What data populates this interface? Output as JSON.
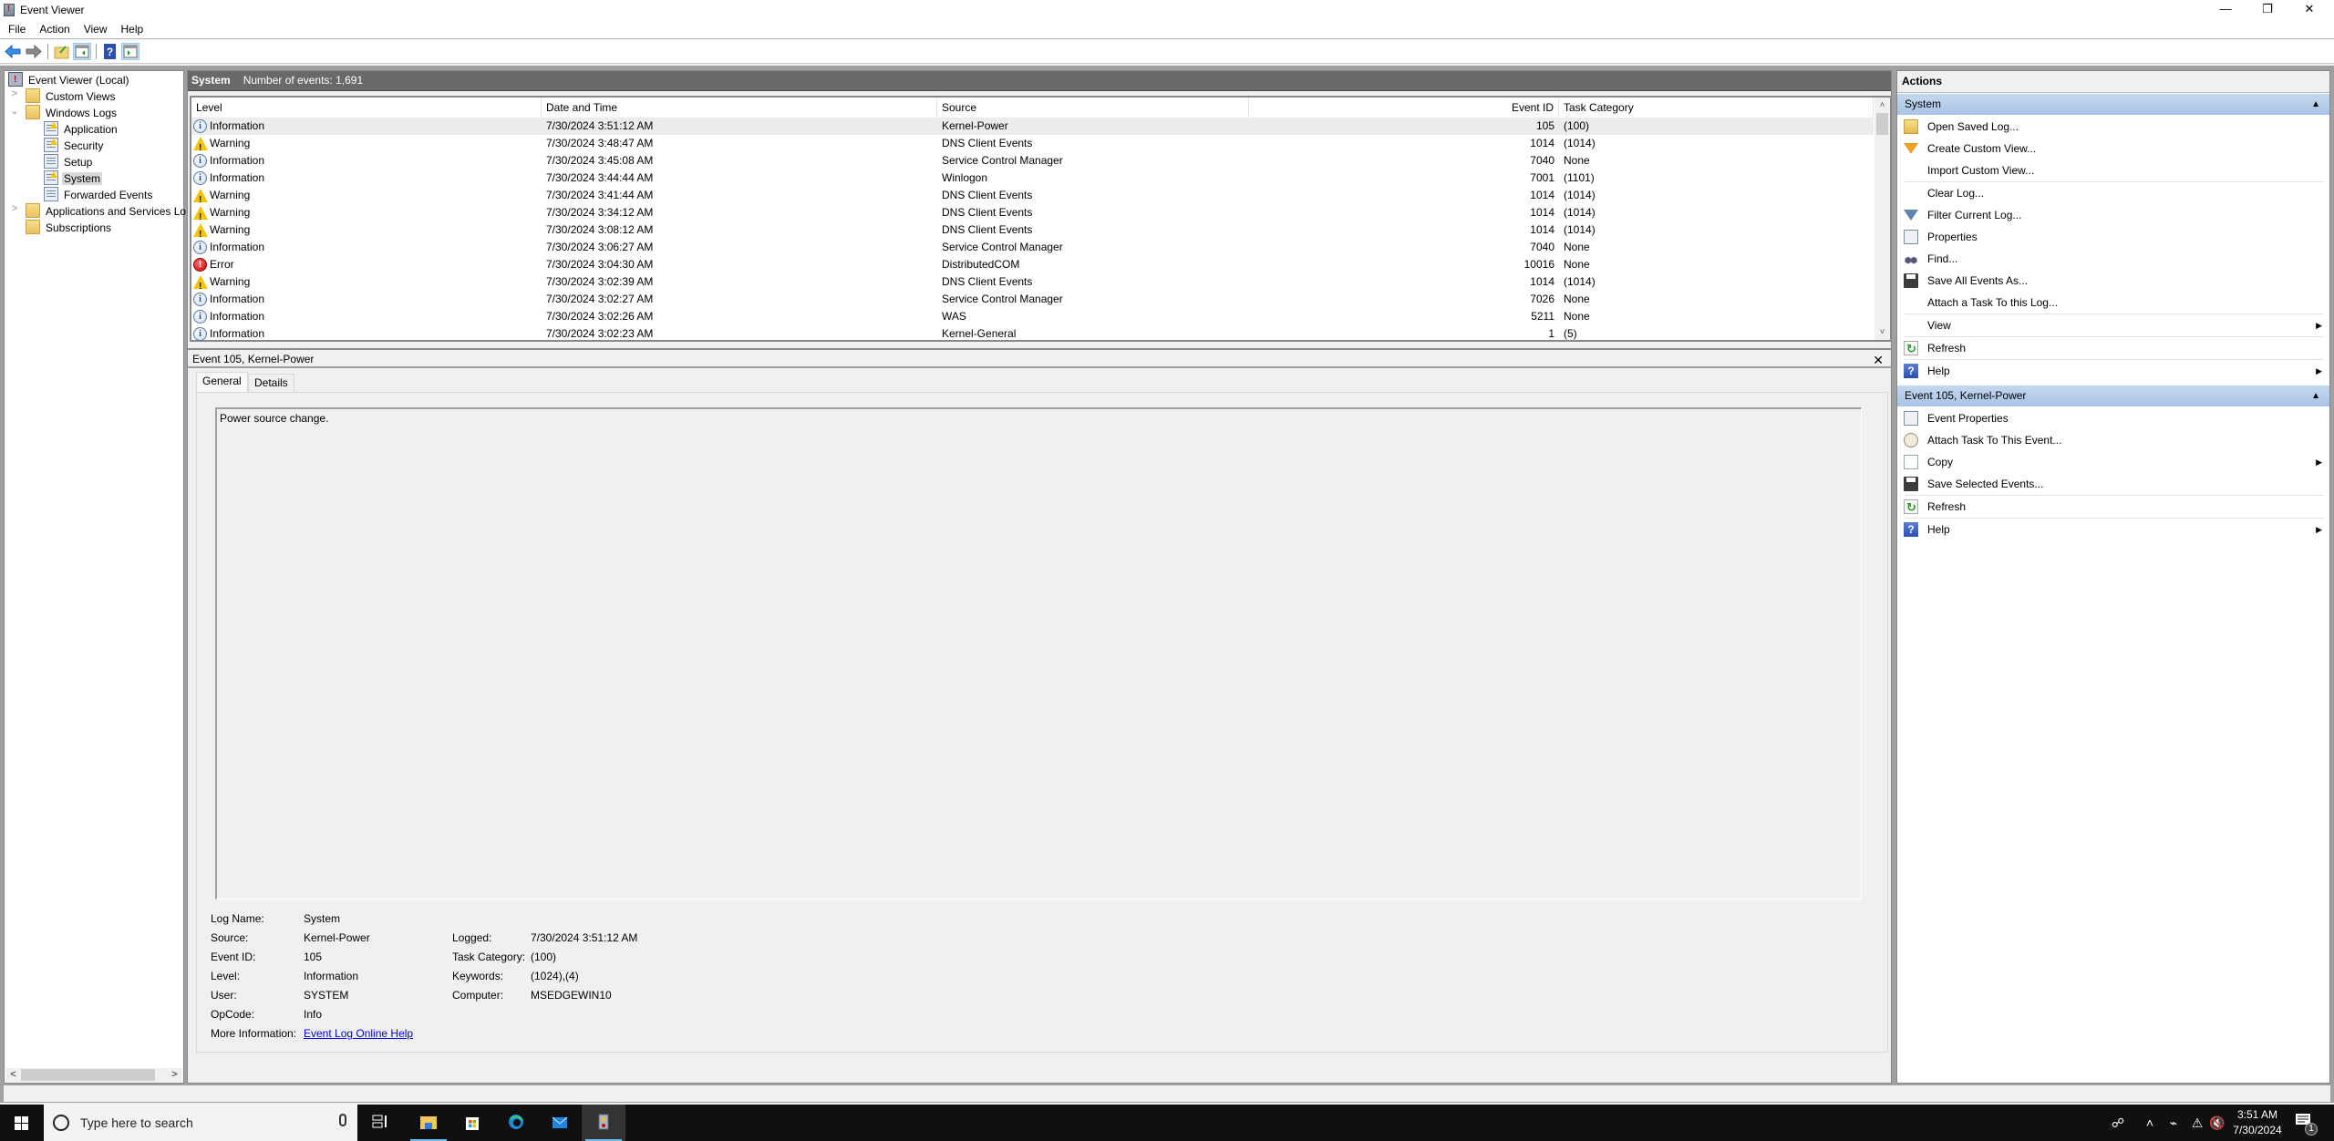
{
  "window": {
    "title": "Event Viewer",
    "controls": {
      "minimize": "—",
      "restore": "❐",
      "close": "✕"
    }
  },
  "menu": [
    "File",
    "Action",
    "View",
    "Help"
  ],
  "toolbar": {
    "buttons": [
      "back-icon",
      "forward-icon",
      "up-folder-icon",
      "show-hide-console-tree-icon",
      "help-icon",
      "show-hide-action-pane-icon"
    ]
  },
  "tree": {
    "items": [
      {
        "label": "Event Viewer (Local)",
        "icon": "event-viewer-icon"
      },
      {
        "label": "Custom Views",
        "icon": "folder-filter-icon",
        "expander": ">"
      },
      {
        "label": "Windows Logs",
        "icon": "folder-computer-icon",
        "expander": "⌄"
      },
      {
        "label": "Application",
        "icon": "log-warning-icon"
      },
      {
        "label": "Security",
        "icon": "log-warning-icon"
      },
      {
        "label": "Setup",
        "icon": "log-icon"
      },
      {
        "label": "System",
        "icon": "log-warning-icon",
        "selected": true
      },
      {
        "label": "Forwarded Events",
        "icon": "log-icon"
      },
      {
        "label": "Applications and Services Lo",
        "icon": "folder-icon",
        "expander": ">"
      },
      {
        "label": "Subscriptions",
        "icon": "subscriptions-icon"
      }
    ],
    "scroll_left": "<",
    "scroll_right": ">"
  },
  "list": {
    "log_name": "System",
    "count_text": "Number of events: 1,691",
    "columns": [
      "Level",
      "Date and Time",
      "Source",
      "Event ID",
      "Task Category"
    ],
    "rows": [
      {
        "level": "Information",
        "icon": "info",
        "datetime": "7/30/2024 3:51:12 AM",
        "source": "Kernel-Power",
        "event_id": "105",
        "task_category": "(100)",
        "selected": true
      },
      {
        "level": "Warning",
        "icon": "warning",
        "datetime": "7/30/2024 3:48:47 AM",
        "source": "DNS Client Events",
        "event_id": "1014",
        "task_category": "(1014)"
      },
      {
        "level": "Information",
        "icon": "info",
        "datetime": "7/30/2024 3:45:08 AM",
        "source": "Service Control Manager",
        "event_id": "7040",
        "task_category": "None"
      },
      {
        "level": "Information",
        "icon": "info",
        "datetime": "7/30/2024 3:44:44 AM",
        "source": "Winlogon",
        "event_id": "7001",
        "task_category": "(1101)"
      },
      {
        "level": "Warning",
        "icon": "warning",
        "datetime": "7/30/2024 3:41:44 AM",
        "source": "DNS Client Events",
        "event_id": "1014",
        "task_category": "(1014)"
      },
      {
        "level": "Warning",
        "icon": "warning",
        "datetime": "7/30/2024 3:34:12 AM",
        "source": "DNS Client Events",
        "event_id": "1014",
        "task_category": "(1014)"
      },
      {
        "level": "Warning",
        "icon": "warning",
        "datetime": "7/30/2024 3:08:12 AM",
        "source": "DNS Client Events",
        "event_id": "1014",
        "task_category": "(1014)"
      },
      {
        "level": "Information",
        "icon": "info",
        "datetime": "7/30/2024 3:06:27 AM",
        "source": "Service Control Manager",
        "event_id": "7040",
        "task_category": "None"
      },
      {
        "level": "Error",
        "icon": "error",
        "datetime": "7/30/2024 3:04:30 AM",
        "source": "DistributedCOM",
        "event_id": "10016",
        "task_category": "None"
      },
      {
        "level": "Warning",
        "icon": "warning",
        "datetime": "7/30/2024 3:02:39 AM",
        "source": "DNS Client Events",
        "event_id": "1014",
        "task_category": "(1014)"
      },
      {
        "level": "Information",
        "icon": "info",
        "datetime": "7/30/2024 3:02:27 AM",
        "source": "Service Control Manager",
        "event_id": "7026",
        "task_category": "None"
      },
      {
        "level": "Information",
        "icon": "info",
        "datetime": "7/30/2024 3:02:26 AM",
        "source": "WAS",
        "event_id": "5211",
        "task_category": "None"
      },
      {
        "level": "Information",
        "icon": "info",
        "datetime": "7/30/2024 3:02:23 AM",
        "source": "Kernel-General",
        "event_id": "1",
        "task_category": "(5)"
      }
    ]
  },
  "detail": {
    "title": "Event 105, Kernel-Power",
    "close": "✕",
    "tabs": [
      "General",
      "Details"
    ],
    "active_tab": "General",
    "description": "Power source change.",
    "fields_left": [
      {
        "label": "Log Name:",
        "value": "System"
      },
      {
        "label": "Source:",
        "value": "Kernel-Power"
      },
      {
        "label": "Event ID:",
        "value": "105"
      },
      {
        "label": "Level:",
        "value": "Information"
      },
      {
        "label": "User:",
        "value": "SYSTEM"
      },
      {
        "label": "OpCode:",
        "value": "Info"
      }
    ],
    "fields_right": [
      {
        "label": "Logged:",
        "value": "7/30/2024 3:51:12 AM"
      },
      {
        "label": "Task Category:",
        "value": "(100)"
      },
      {
        "label": "Keywords:",
        "value": "(1024),(4)"
      },
      {
        "label": "Computer:",
        "value": "MSEDGEWIN10"
      }
    ],
    "more_info_label": "More Information:",
    "more_info_link": "Event Log Online Help"
  },
  "actions": {
    "title": "Actions",
    "groups": [
      {
        "title": "System",
        "items": [
          {
            "label": "Open Saved Log...",
            "icon": "open-folder"
          },
          {
            "label": "Create Custom View...",
            "icon": "funnel-orange"
          },
          {
            "label": "Import Custom View...",
            "icon": ""
          },
          {
            "label": "Clear Log...",
            "icon": ""
          },
          {
            "label": "Filter Current Log...",
            "icon": "funnel-blue"
          },
          {
            "label": "Properties",
            "icon": "properties"
          },
          {
            "label": "Find...",
            "icon": "binoculars"
          },
          {
            "label": "Save All Events As...",
            "icon": "save"
          },
          {
            "label": "Attach a Task To this Log...",
            "icon": ""
          },
          {
            "label": "View",
            "icon": "",
            "submenu": true
          },
          {
            "label": "Refresh",
            "icon": "refresh"
          },
          {
            "label": "Help",
            "icon": "help",
            "submenu": true
          }
        ]
      },
      {
        "title": "Event 105, Kernel-Power",
        "items": [
          {
            "label": "Event Properties",
            "icon": "properties"
          },
          {
            "label": "Attach Task To This Event...",
            "icon": "task"
          },
          {
            "label": "Copy",
            "icon": "copy",
            "submenu": true
          },
          {
            "label": "Save Selected Events...",
            "icon": "save"
          },
          {
            "label": "Refresh",
            "icon": "refresh"
          },
          {
            "label": "Help",
            "icon": "help",
            "submenu": true
          }
        ]
      }
    ]
  },
  "taskbar": {
    "search_placeholder": "Type here to search",
    "apps": [
      "task-view",
      "file-explorer",
      "microsoft-store",
      "edge",
      "mail",
      "event-viewer"
    ],
    "time": "3:51 AM",
    "date": "7/30/2024",
    "notification_count": "1"
  }
}
